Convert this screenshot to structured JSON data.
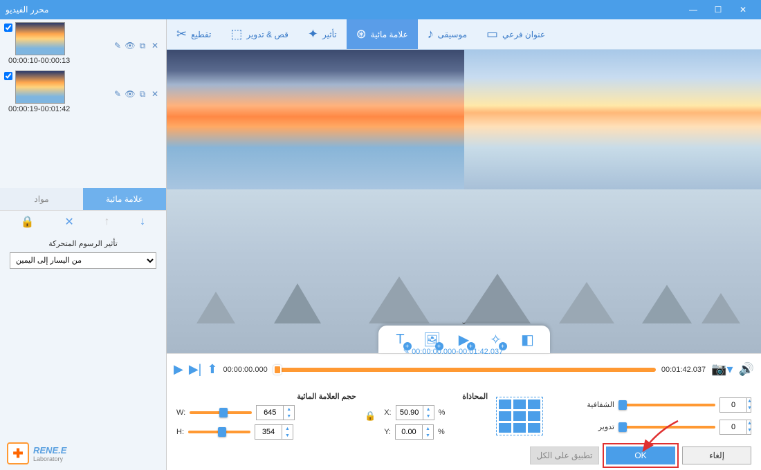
{
  "titlebar": {
    "title": "محرر الفيديو"
  },
  "clips": [
    {
      "time": "00:00:10-00:00:13"
    },
    {
      "time": "00:00:19-00:01:42"
    }
  ],
  "sidebarTabs": {
    "watermark": "علامة مائية",
    "materials": "مواد"
  },
  "effect": {
    "label": "تأثير الرسوم المتحركة",
    "value": "من اليسار إلى اليمين"
  },
  "logo": {
    "name": "RENE.E",
    "sub": "Laboratory"
  },
  "toolbar": {
    "cut": "تقطيع",
    "croprotate": "قص & تدوير",
    "effect": "تأثير",
    "watermark": "علامة مائية",
    "music": "موسيقى",
    "subtitle": "عنوان فرعي"
  },
  "timeline": {
    "start": "00:00:00.000",
    "range": "00:00:00.000-00:01:42.037",
    "end": "00:01:42.037"
  },
  "size": {
    "header": "حجم العلامة المائية",
    "w_label": "W:",
    "w": "645",
    "h_label": "H:",
    "h": "354"
  },
  "align": {
    "header": "المحاذاة",
    "x_label": "X:",
    "x": "50.90",
    "y_label": "Y:",
    "y": "0.00",
    "pct": "%"
  },
  "opacity": {
    "label": "الشفافية",
    "value": "0"
  },
  "rotation": {
    "label": "تدوير",
    "value": "0"
  },
  "buttons": {
    "applyall": "تطبيق على الكل",
    "ok": "OK",
    "cancel": "إلغاء"
  }
}
